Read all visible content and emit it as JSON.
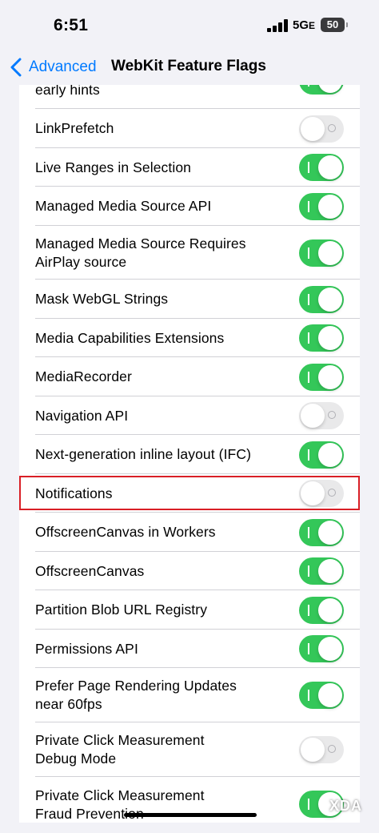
{
  "status_bar": {
    "time": "6:51",
    "network": "5G",
    "network_suffix": "E",
    "battery": "50"
  },
  "nav": {
    "back_label": "Advanced",
    "title": "WebKit Feature Flags"
  },
  "colors": {
    "toggle_on": "#34c759",
    "toggle_off": "#e9e9ea",
    "accent": "#007aff",
    "highlight_border": "#d91f26"
  },
  "flags": [
    {
      "label_lines": [
        "early hints"
      ],
      "enabled": true
    },
    {
      "label_lines": [
        "LinkPrefetch"
      ],
      "enabled": false
    },
    {
      "label_lines": [
        "Live Ranges in Selection"
      ],
      "enabled": true
    },
    {
      "label_lines": [
        "Managed Media Source API"
      ],
      "enabled": true
    },
    {
      "label_lines": [
        "Managed Media Source Requires",
        "AirPlay source"
      ],
      "enabled": true
    },
    {
      "label_lines": [
        "Mask WebGL Strings"
      ],
      "enabled": true
    },
    {
      "label_lines": [
        "Media Capabilities Extensions"
      ],
      "enabled": true
    },
    {
      "label_lines": [
        "MediaRecorder"
      ],
      "enabled": true
    },
    {
      "label_lines": [
        "Navigation API"
      ],
      "enabled": false
    },
    {
      "label_lines": [
        "Next-generation inline layout (IFC)"
      ],
      "enabled": true
    },
    {
      "label_lines": [
        "Notifications"
      ],
      "enabled": false,
      "highlighted": true
    },
    {
      "label_lines": [
        "OffscreenCanvas in Workers"
      ],
      "enabled": true
    },
    {
      "label_lines": [
        "OffscreenCanvas"
      ],
      "enabled": true
    },
    {
      "label_lines": [
        "Partition Blob URL Registry"
      ],
      "enabled": true
    },
    {
      "label_lines": [
        "Permissions API"
      ],
      "enabled": true
    },
    {
      "label_lines": [
        "Prefer Page Rendering Updates",
        "near 60fps"
      ],
      "enabled": true
    },
    {
      "label_lines": [
        "Private Click Measurement",
        "Debug Mode"
      ],
      "enabled": false
    },
    {
      "label_lines": [
        "Private Click Measurement",
        "Fraud Prevention"
      ],
      "enabled": true
    }
  ],
  "watermark": "XDA"
}
